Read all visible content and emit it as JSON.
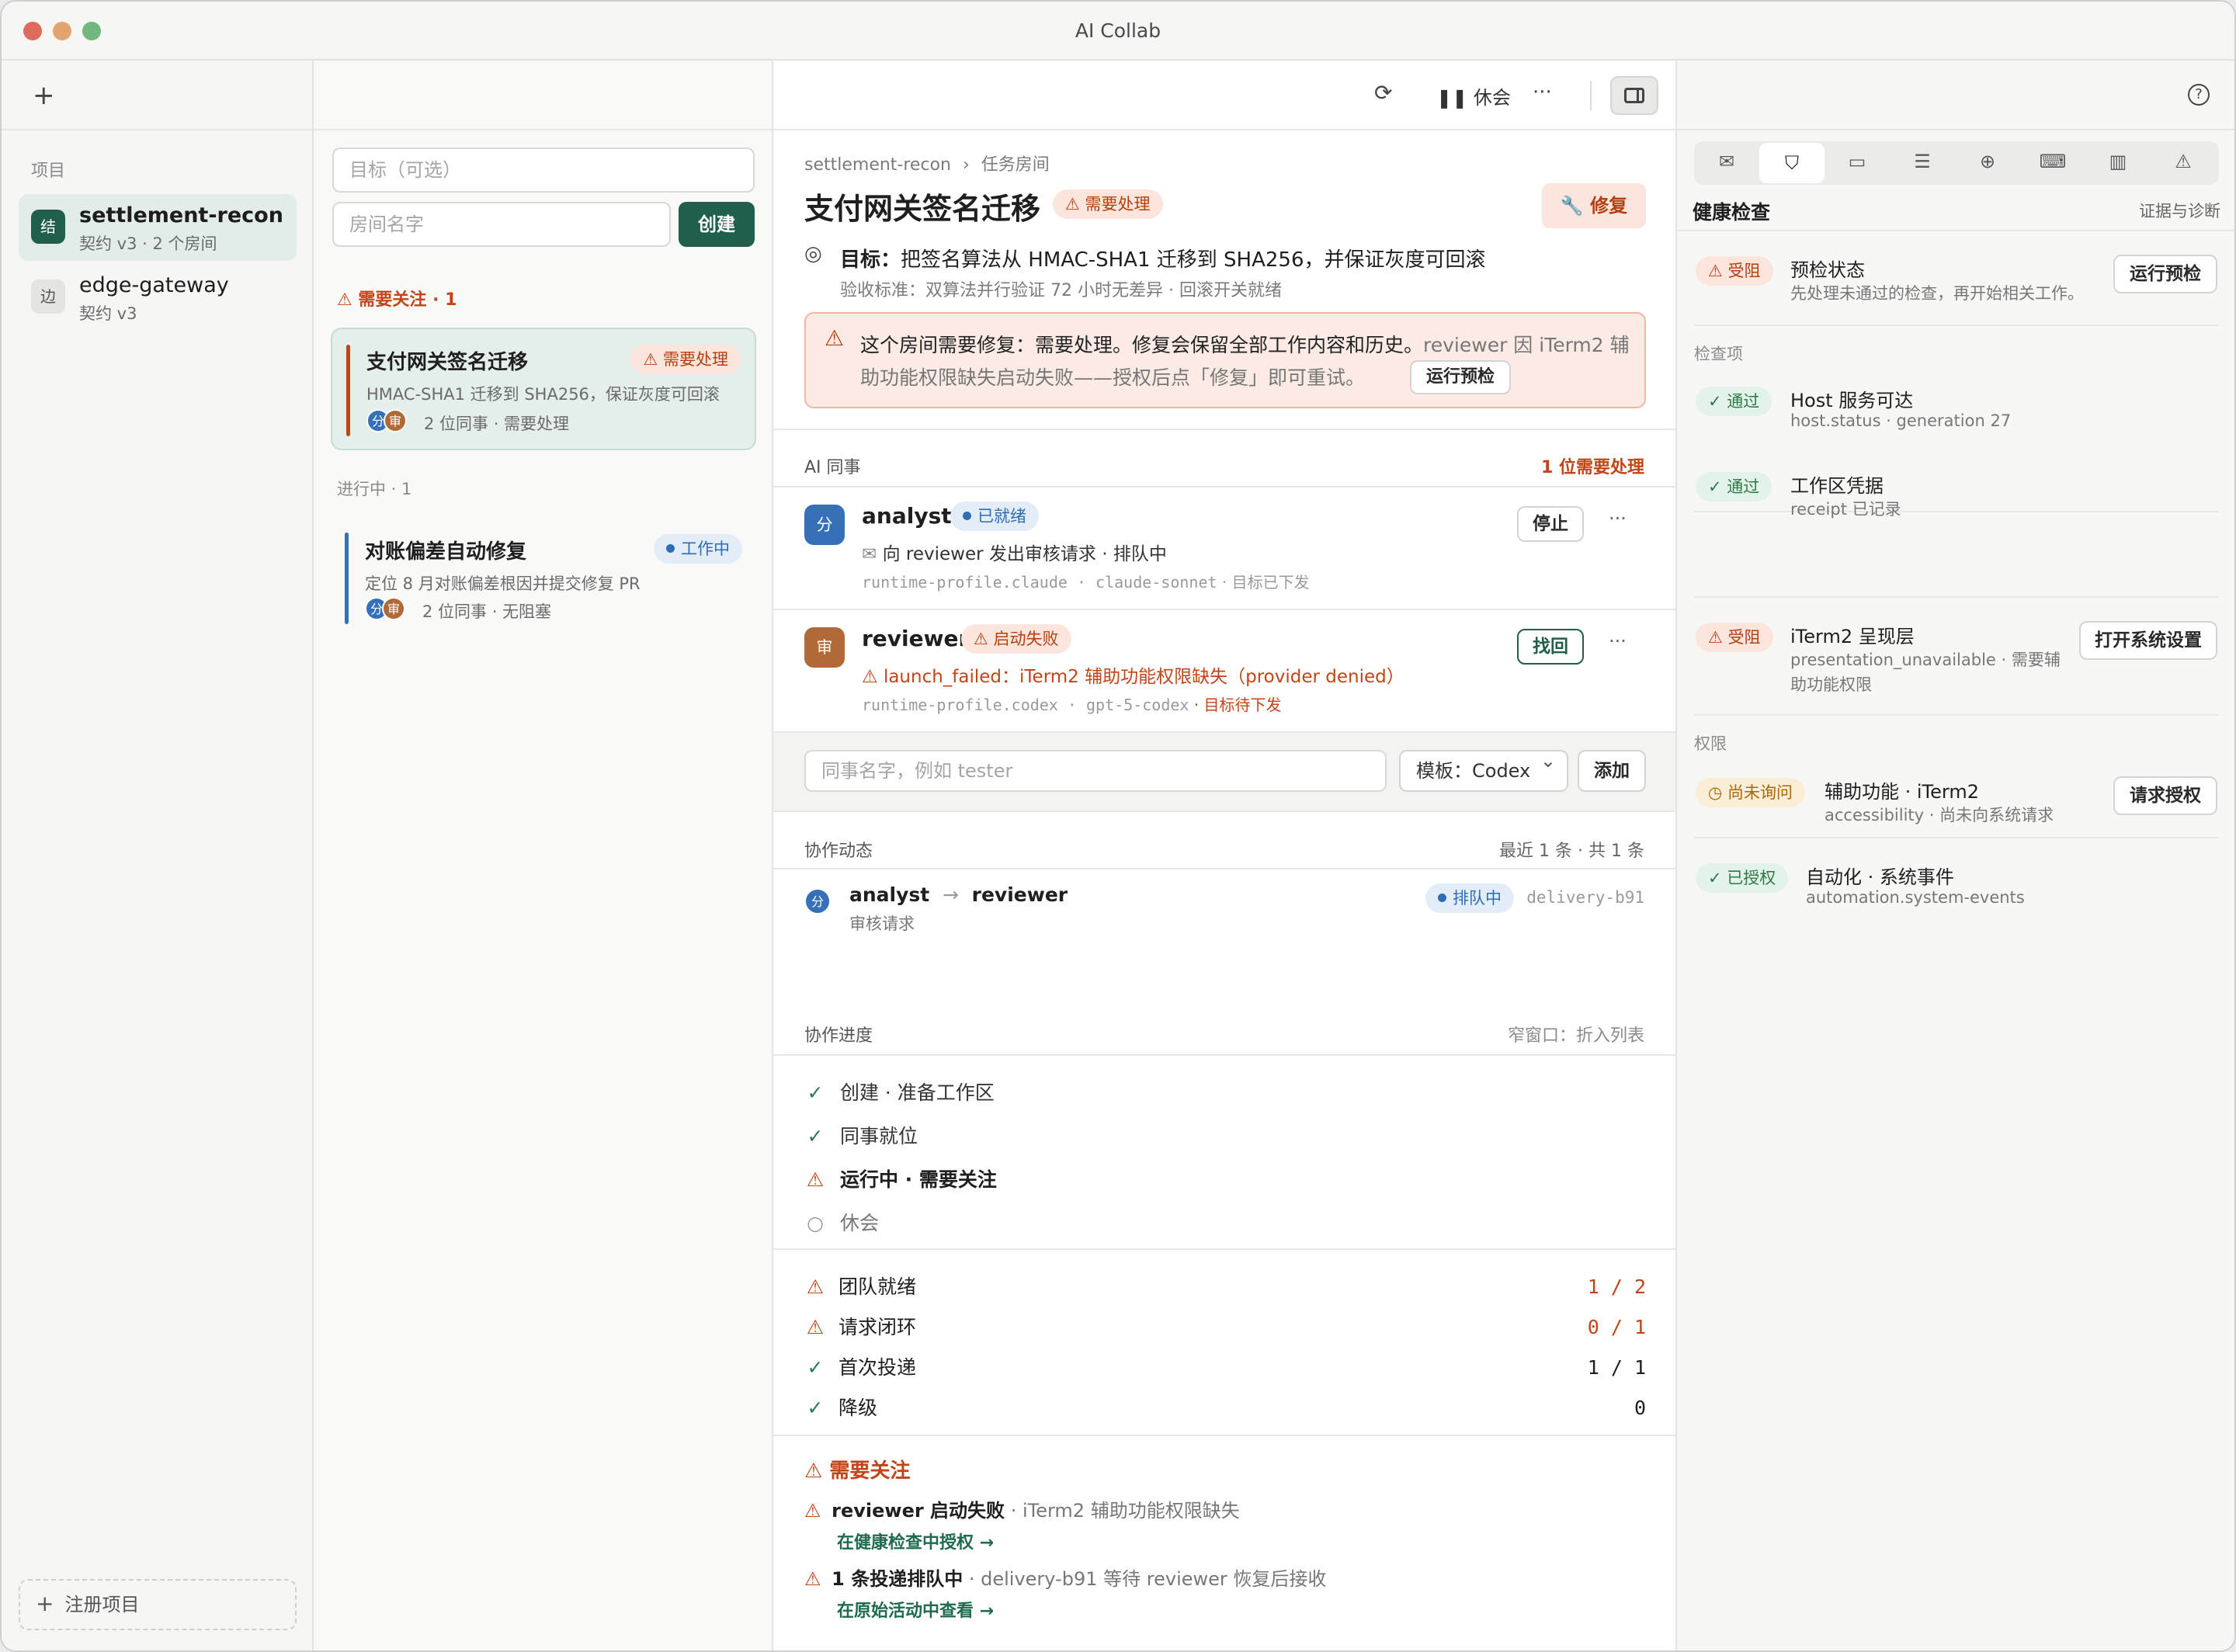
{
  "window": {
    "title": "AI Collab"
  },
  "colors": {
    "accent": "#1f5f4c",
    "warn": "#c0461a",
    "blue": "#2f6db4",
    "ok": "#2e7b4a",
    "analyst_avatar": "#3670b8",
    "reviewer_avatar": "#b06a38"
  },
  "sidebar": {
    "add_icon": "plus-icon",
    "section_label": "项目",
    "projects": [
      {
        "avatar": "结",
        "name": "settlement-recon",
        "meta": "契约 v3 · 2 个房间"
      },
      {
        "avatar": "边",
        "name": "edge-gateway",
        "meta": "契约 v3"
      }
    ],
    "register_label": "注册项目"
  },
  "rooms": {
    "goal_placeholder": "目标（可选）",
    "name_placeholder": "房间名字",
    "create_label": "创建",
    "attention_header": "需要关注 · 1",
    "active_header": "进行中 · 1",
    "cards": [
      {
        "title": "支付网关签名迁移",
        "badge": "需要处理",
        "desc": "HMAC-SHA1 迁移到 SHA256，保证灰度可回滚",
        "av1": "分",
        "av2": "审",
        "meta": "2 位同事 · 需要处理"
      },
      {
        "title": "对账偏差自动修复",
        "badge": "工作中",
        "desc": "定位 8 月对账偏差根因并提交修复 PR",
        "av1": "分",
        "av2": "审",
        "meta": "2 位同事 · 无阻塞"
      }
    ]
  },
  "toolbar": {
    "pause_label": "休会",
    "more": "···"
  },
  "room": {
    "breadcrumb_project": "settlement-recon",
    "breadcrumb_sep": "›",
    "breadcrumb_page": "任务房间",
    "title": "支付网关签名迁移",
    "status_badge": "需要处理",
    "repair_label": "修复",
    "goal_label": "目标：",
    "goal_text": "把签名算法从 HMAC-SHA1 迁移到 SHA256，并保证灰度可回滚",
    "acceptance": "验收标准：双算法并行验证 72 小时无差异 · 回滚开关就绪",
    "alert_main": "这个房间需要修复：需要处理。修复会保留全部工作内容和历史。",
    "alert_detail_a": "reviewer 因 iTerm2 辅",
    "alert_detail_b": "助功能权限缺失启动失败——授权后点「修复」即可重试。",
    "alert_btn": "运行预检"
  },
  "colleagues": {
    "header": "AI 同事",
    "header_right": "1 位需要处理",
    "list": [
      {
        "avatar": "分",
        "name": "analyst",
        "status": "已就绪",
        "line": "向 reviewer 发出审核请求 · 排队中",
        "profile": "runtime-profile.claude · claude-sonnet",
        "target": "· 目标已下发",
        "action": "停止"
      },
      {
        "avatar": "审",
        "name": "reviewer",
        "status": "启动失败",
        "line": "launch_failed：iTerm2 辅助功能权限缺失（provider denied）",
        "profile": "runtime-profile.codex · gpt-5-codex",
        "target": "· 目标待下发",
        "action": "找回"
      }
    ],
    "add_placeholder": "同事名字，例如 tester",
    "template_label": "模板：Codex",
    "add_label": "添加"
  },
  "activity": {
    "header": "协作动态",
    "header_right": "最近 1 条 · 共 1 条",
    "from": "analyst",
    "to": "reviewer",
    "sub": "审核请求",
    "badge": "排队中",
    "id": "delivery-b91",
    "avatar": "分"
  },
  "progress": {
    "header": "协作进度",
    "header_right": "窄窗口：折入列表",
    "steps": [
      "创建 · 准备工作区",
      "同事就位",
      "运行中 · 需要关注",
      "休会"
    ]
  },
  "metrics": [
    {
      "label": "团队就绪",
      "value": "1 / 2"
    },
    {
      "label": "请求闭环",
      "value": "0 / 1"
    },
    {
      "label": "首次投递",
      "value": "1 / 1"
    },
    {
      "label": "降级",
      "value": "0"
    }
  ],
  "attention": {
    "header": "需要关注",
    "items": [
      {
        "title": "reviewer 启动失败",
        "detail": "· iTerm2 辅助功能权限缺失",
        "link": "在健康检查中授权 →"
      },
      {
        "title": "1 条投递排队中",
        "detail": "· delivery-b91 等待 reviewer 恢复后接收",
        "link": "在原始活动中查看 →"
      }
    ]
  },
  "health": {
    "title": "健康检查",
    "right_link": "证据与诊断",
    "preflight": {
      "badge": "受阻",
      "title": "预检状态",
      "desc": "先处理未通过的检查，再开始相关工作。",
      "action": "运行预检"
    },
    "checks_label": "检查项",
    "checks": [
      {
        "badge": "通过",
        "title": "Host 服务可达",
        "desc": "host.status · generation 27"
      },
      {
        "badge": "通过",
        "title": "工作区凭据",
        "desc": "receipt 已记录"
      },
      {
        "badge": "受阻",
        "title": "iTerm2 呈现层",
        "desc1": "presentation_unavailable · 需要辅",
        "desc2": "助功能权限",
        "action": "打开系统设置"
      }
    ],
    "perm_label": "权限",
    "perms": [
      {
        "badge": "尚未询问",
        "title": "辅助功能 · iTerm2",
        "desc": "accessibility · 尚未向系统请求",
        "action": "请求授权"
      },
      {
        "badge": "已授权",
        "title": "自动化 · 系统事件",
        "desc": "automation.system-events"
      }
    ]
  }
}
